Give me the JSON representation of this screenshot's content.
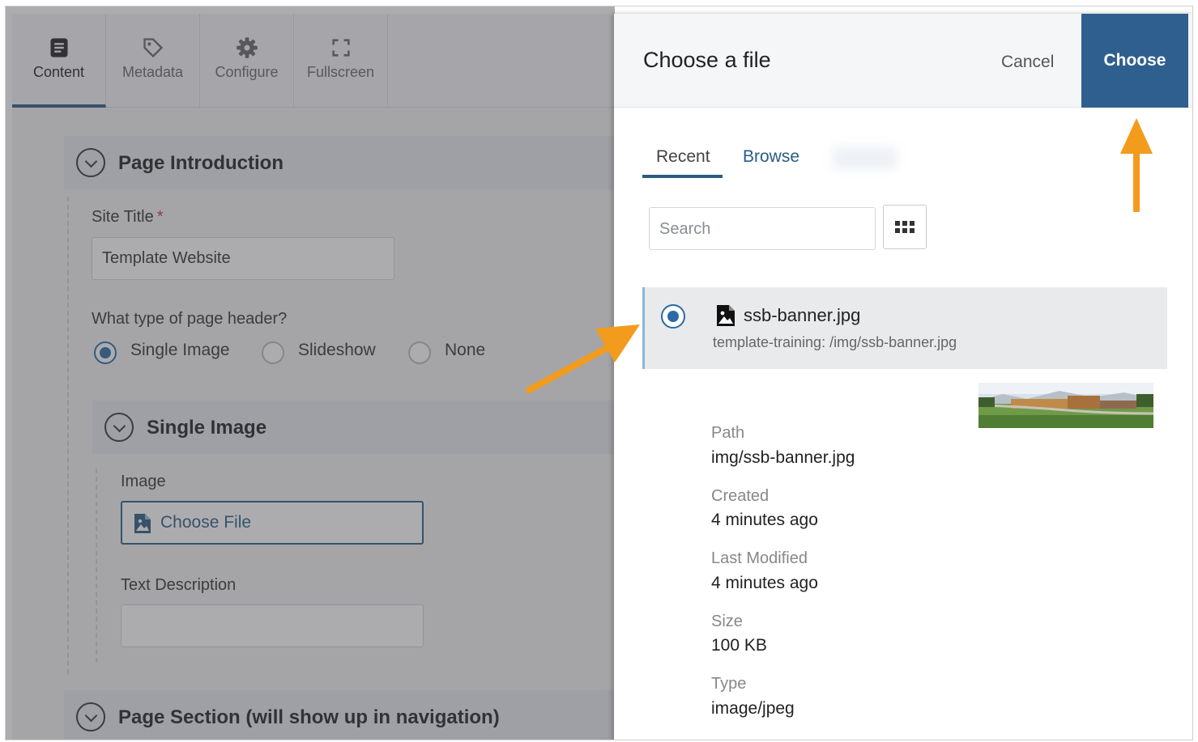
{
  "toolbar": {
    "items": [
      {
        "label": "Content",
        "icon": "document-icon"
      },
      {
        "label": "Metadata",
        "icon": "tag-icon"
      },
      {
        "label": "Configure",
        "icon": "gear-icon"
      },
      {
        "label": "Fullscreen",
        "icon": "fullscreen-icon"
      }
    ],
    "active": "Content"
  },
  "form": {
    "intro_title": "Page Introduction",
    "site_title_label": "Site Title",
    "required_mark": "*",
    "site_title_value": "Template Website",
    "header_question": "What type of page header?",
    "header_options": [
      "Single Image",
      "Slideshow",
      "None"
    ],
    "header_selected": "Single Image",
    "single_image_title": "Single Image",
    "image_label": "Image",
    "choose_file_label": "Choose File",
    "text_description_label": "Text Description",
    "text_description_value": "",
    "page_section_title": "Page Section (will show up in navigation)"
  },
  "dialog": {
    "title": "Choose a file",
    "cancel_label": "Cancel",
    "choose_label": "Choose",
    "tabs": [
      "Recent",
      "Browse"
    ],
    "active_tab": "Recent",
    "search_placeholder": "Search",
    "file": {
      "name": "ssb-banner.jpg",
      "location": "template-training: /img/ssb-banner.jpg",
      "selected": true
    },
    "details": [
      {
        "term": "Path",
        "value": "img/ssb-banner.jpg"
      },
      {
        "term": "Created",
        "value": "4 minutes ago"
      },
      {
        "term": "Last Modified",
        "value": "4 minutes ago"
      },
      {
        "term": "Size",
        "value": "100 KB"
      },
      {
        "term": "Type",
        "value": "image/jpeg"
      }
    ]
  },
  "colors": {
    "accent": "#2f5f8f",
    "annotation_arrow": "#f39b1c"
  }
}
